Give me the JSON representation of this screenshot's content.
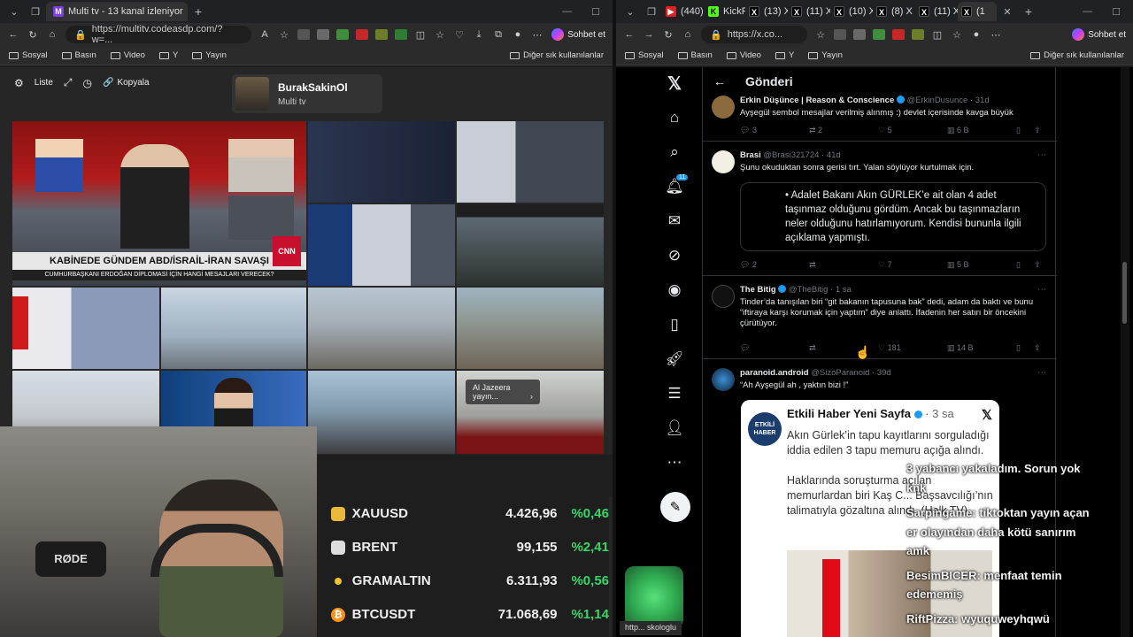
{
  "left_window": {
    "tab_title": "Multi tv - 13 kanal izleniyor",
    "url": "https://multitv.codeasdp.com/?w=...",
    "chat_label": "Sohbet et",
    "bookmarks": [
      "Sosyal",
      "Basın",
      "Video",
      "Y",
      "Yayın"
    ],
    "other_bookmarks": "Diğer sık kullanılanlar",
    "toolbar": {
      "list_label": "Liste",
      "copy_label": "Kopyala"
    },
    "channel": {
      "name": "BurakSakinOl",
      "subtitle": "Multi tv"
    },
    "news_banner": "KABİNEDE GÜNDEM ABD/İSRAİL-İRAN SAVAŞI",
    "news_sub": "CUMHURBAŞKANI ERDOĞAN DİPLOMASİ İÇİN HANGİ MESAJLARI VERECEK?",
    "aj_button": "Al Jazeera yayın...",
    "prices": [
      {
        "symbol": "XAUUSD",
        "value": "4.426,96",
        "change": "%0,46",
        "color": "#e8b93a"
      },
      {
        "symbol": "BRENT",
        "value": "99,155",
        "change": "%2,41",
        "color": "#dddddd"
      },
      {
        "symbol": "GRAMALTIN",
        "value": "6.311,93",
        "change": "%0,56",
        "color": "#f2c230"
      },
      {
        "symbol": "BTCUSDT",
        "value": "71.068,69",
        "change": "%1,14",
        "color": "#f7931a"
      }
    ]
  },
  "right_window": {
    "tabs": [
      "(440)",
      "KickPe",
      "(13) X",
      "(11) X",
      "(10) X",
      "(8) X",
      "(11) X",
      "(1"
    ],
    "url": "https://x.co...",
    "chat_label": "Sohbet et",
    "bookmarks": [
      "Sosyal",
      "Basın",
      "Video",
      "Y",
      "Yayın"
    ],
    "other_bookmarks": "Diğer sık kullanılanlar",
    "header_title": "Gönderi",
    "notif_count": "11",
    "tweets": [
      {
        "name": "Erkin Düşünce | Reason & Conscience",
        "handle": "@ErkinDusunce · 31d",
        "text": "Ayşegül sembol mesajlar verilmiş alınmış :) devlet içerisinde kavga büyük",
        "replies": "3",
        "retweets": "2",
        "likes": "5",
        "views": "6 B"
      },
      {
        "name": "Brasi",
        "handle": "@Brasi321724 · 41d",
        "text": "Şunu okuduktan sonra gerisi tırt.  Yalan söylüyor kurtulmak için.",
        "quote": "• Adalet Bakanı Akın GÜRLEK’e ait olan 4 adet taşınmaz olduğunu gördüm. Ancak bu taşınmazların neler olduğunu hatırlamıyorum. Kendisi bununla ilgili açıklama yapmıştı.",
        "replies": "2",
        "retweets": "",
        "likes": "7",
        "views": "5 B"
      },
      {
        "name": "The Bitig",
        "handle": "@TheBitig · 1 sa",
        "text": "Tinder’da tanışılan biri “git bakanın tapusuna bak” dedi, adam da baktı ve bunu “iftiraya karşı korumak için yaptım” diye anlattı. İfadenin her satırı bir öncekini çürütüyor.",
        "replies": "",
        "retweets": "",
        "likes": "181",
        "views": "14 B"
      },
      {
        "name": "paranoid.android",
        "handle": "@SizoParanoid · 39d",
        "text": "“Ah Ayşegül ah , yaktın bizi !”"
      }
    ],
    "quoted_card": {
      "name": "Etkili Haber Yeni Sayfa",
      "time": "· 3 sa",
      "logo": "ETKİLİ HABER",
      "text": "Akın Gürlek’in tapu kayıtlarını sorguladığı iddia edilen 3 tapu memuru açığa alındı.\n\nHaklarında soruşturma açılan memurlardan biri Kaş C... Başsavcılığı’nın talimatıyla gözaltına alındı. (Halk TV)"
    }
  },
  "stream_chat": [
    "3 yabancı yakaladım. Sorun yok",
    "knk",
    "Sarpingame: tiktoktan yayın açan",
    "er olayından daha kötü sanırım",
    "amk",
    "BesimBICER: menfaat temin",
    "edememiş",
    "RiftPizza: wyuquweyhqwü"
  ],
  "footer_label": "http... skologlu"
}
